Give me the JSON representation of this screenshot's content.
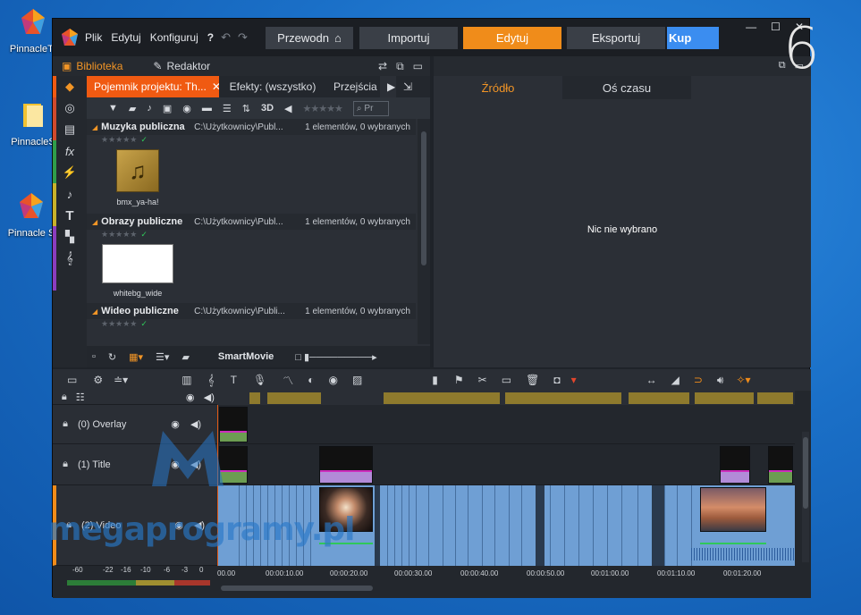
{
  "desktop": {
    "icons": [
      {
        "label": "PinnacleTr",
        "icon": "pinnacle-logo-icon"
      },
      {
        "label": "PinnacleS",
        "icon": "folder-icon"
      },
      {
        "label": "Pinnacle S",
        "icon": "pinnacle-logo-icon"
      }
    ],
    "overlay_number": "6"
  },
  "menu": {
    "file": "Plik",
    "edit": "Edytuj",
    "configure": "Konfiguruj",
    "help": "?"
  },
  "nav": {
    "guide": "Przewodn",
    "import": "Importuj",
    "edit": "Edytuj",
    "export": "Eksportuj",
    "buy": "Kup",
    "active": "Edytuj"
  },
  "library": {
    "tabs": {
      "library": "Biblioteka",
      "editor": "Redaktor"
    },
    "project_tabs": [
      {
        "label": "Pojemnik projektu: Th...",
        "active": true
      },
      {
        "label": "Efekty: (wszystko)",
        "active": false
      },
      {
        "label": "Przejścia",
        "active": false
      }
    ],
    "toolbar": {
      "three_d": "3D",
      "search_placeholder": "Pr"
    },
    "groups": [
      {
        "name": "Muzyka publiczna",
        "path": "C:\\Użytkownicy\\Publ...",
        "count": "1 elementów, 0 wybranych",
        "asset": "bmx_ya-ha!"
      },
      {
        "name": "Obrazy publiczne",
        "path": "C:\\Użytkownicy\\Publ...",
        "count": "1 elementów, 0 wybranych",
        "asset": "whitebg_wide"
      },
      {
        "name": "Wideo publiczne",
        "path": "C:\\Użytkownicy\\Publi...",
        "count": "1 elementów, 0 wybranych"
      }
    ],
    "smartmovie": "SmartMovie"
  },
  "source": {
    "tabs": [
      "Źródło",
      "Oś czasu"
    ],
    "active_tab": "Źródło",
    "empty_text": "Nic nie wybrano"
  },
  "timeline": {
    "tracks": [
      {
        "name": "(0) Overlay"
      },
      {
        "name": "(1) Title"
      },
      {
        "name": "(2) Video"
      }
    ],
    "ruler_labels": [
      "00.00",
      "00:00:10.00",
      "00:00:20.00",
      "00:00:30.00",
      "00:00:40.00",
      "00:00:50.00",
      "00:01:00.00",
      "00:01:10.00",
      "00:01:20.00"
    ],
    "vu_labels": [
      "-60",
      "-22",
      "-16",
      "-10",
      "-6",
      "-3",
      "0"
    ]
  },
  "watermark": "megaprogramy.pl",
  "colors": {
    "accent_orange": "#f08c1a",
    "tab_red_orange": "#f05a12",
    "buy_blue": "#3b8df0",
    "clip_green": "#6c9d52",
    "clip_purple": "#b28bd8",
    "video_blue": "#6f9fd4"
  }
}
